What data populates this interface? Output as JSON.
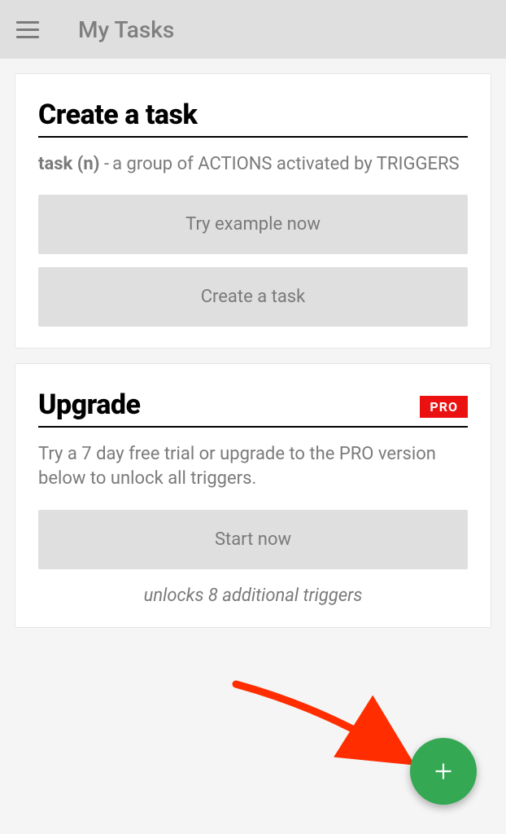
{
  "header": {
    "title": "My Tasks"
  },
  "card_create": {
    "title": "Create a task",
    "def_term": "task (n)",
    "def_sep": "-",
    "def_body": "a group of ACTIONS activated by TRIGGERS",
    "try_example_label": "Try example now",
    "create_task_label": "Create a task"
  },
  "card_upgrade": {
    "title": "Upgrade",
    "badge": "PRO",
    "body": "Try a 7 day free trial or upgrade to the PRO version below to unlock all triggers.",
    "start_now_label": "Start now",
    "unlock_note": "unlocks 8 additional triggers"
  },
  "fab": {
    "label": "+"
  },
  "colors": {
    "accent_green": "#34a853",
    "badge_red": "#eb1111",
    "arrow_red": "#ff2d00"
  }
}
